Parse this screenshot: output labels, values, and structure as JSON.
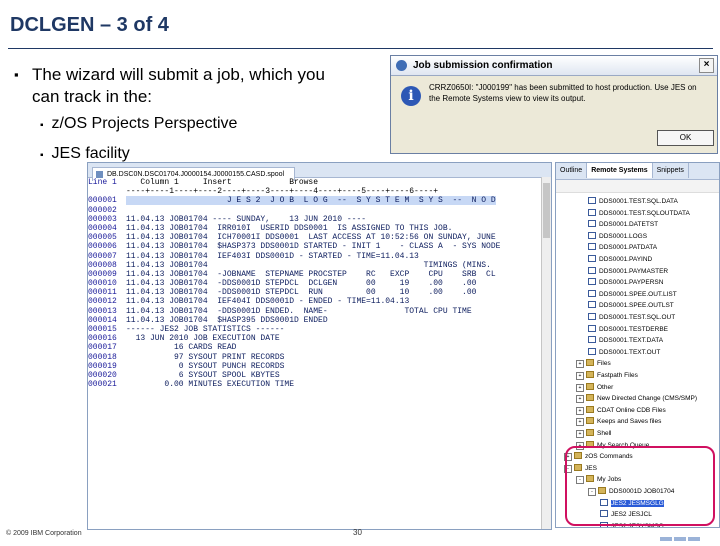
{
  "slide": {
    "title": "DCLGEN – 3 of 4",
    "bullet_main_line1": "The wizard will submit a job, which you",
    "bullet_main_line2": "can track in the:",
    "bullet_sub1": "z/OS Projects Perspective",
    "bullet_sub2": "JES facility",
    "footer_copyright": "© 2009 IBM Corporation",
    "page_number": "30"
  },
  "dialog": {
    "title": "Job submission confirmation",
    "message": "CRRZ0650I: \"J000199\" has been submitted to host production. Use JES on the Remote Systems view to view its output.",
    "ok_label": "OK",
    "close_glyph": "×",
    "info_glyph": "i"
  },
  "editor": {
    "tab_label": "DB.DSC0N.DSC01704.J0000154.J0000155.CASD.spool",
    "rows": [
      {
        "ln": "Line 1",
        "txt": "   Column 1     Insert            Browse",
        "hdr": true
      },
      {
        "ln": "",
        "txt": "----+----1----+----2----+----3----+----4----+----5----+----6----+",
        "hdr": true
      },
      {
        "ln": "000001",
        "txt": "                     J E S 2  J O B  L O G  --  S Y S T E M  S Y S  --  N O D",
        "hl": true
      },
      {
        "ln": "000002",
        "txt": ""
      },
      {
        "ln": "000003",
        "txt": "11.04.13 JOB01704 ---- SUNDAY,    13 JUN 2010 ----"
      },
      {
        "ln": "000004",
        "txt": "11.04.13 JOB01704  IRR010I  USERID DDS0001  IS ASSIGNED TO THIS JOB."
      },
      {
        "ln": "000005",
        "txt": "11.04.13 JOB01704  ICH70001I DDS0001  LAST ACCESS AT 10:52:56 ON SUNDAY, JUNE"
      },
      {
        "ln": "000006",
        "txt": "11.04.13 JOB01704  $HASP373 DDS0001D STARTED - INIT 1    - CLASS A  - SYS NODE"
      },
      {
        "ln": "000007",
        "txt": "11.04.13 JOB01704  IEF403I DDS0001D - STARTED - TIME=11.04.13"
      },
      {
        "ln": "000008",
        "txt": "11.04.13 JOB01704                                             TIMINGS (MINS."
      },
      {
        "ln": "000009",
        "txt": "11.04.13 JOB01704  -JOBNAME  STEPNAME PROCSTEP    RC   EXCP    CPU    SRB  CL"
      },
      {
        "ln": "000010",
        "txt": "11.04.13 JOB01704  -DDS0001D STEPDCL  DCLGEN      00     19    .00    .00"
      },
      {
        "ln": "000011",
        "txt": "11.04.13 JOB01704  -DDS0001D STEPDCL  RUN         00     10    .00    .00"
      },
      {
        "ln": "000012",
        "txt": "11.04.13 JOB01704  IEF404I DDS0001D - ENDED - TIME=11.04.13"
      },
      {
        "ln": "000013",
        "txt": "11.04.13 JOB01704  -DDS0001D ENDED.  NAME-                TOTAL CPU TIME"
      },
      {
        "ln": "000014",
        "txt": "11.04.13 JOB01704  $HASP395 DDS0001D ENDED"
      },
      {
        "ln": "000015",
        "txt": "------ JES2 JOB STATISTICS ------"
      },
      {
        "ln": "000016",
        "txt": "  13 JUN 2010 JOB EXECUTION DATE"
      },
      {
        "ln": "000017",
        "txt": "          16 CARDS READ"
      },
      {
        "ln": "000018",
        "txt": "          97 SYSOUT PRINT RECORDS"
      },
      {
        "ln": "000019",
        "txt": "           0 SYSOUT PUNCH RECORDS"
      },
      {
        "ln": "000020",
        "txt": "           6 SYSOUT SPOOL KBYTES"
      },
      {
        "ln": "000021",
        "txt": "        0.00 MINUTES EXECUTION TIME"
      }
    ]
  },
  "remote_panel": {
    "tabs": [
      "Outline",
      "Remote Systems",
      "Snippets"
    ],
    "active_tab": "Remote Systems",
    "tree": [
      {
        "label": "DDS0001.TEST.SQL.DATA",
        "depth": 3,
        "kind": "ds"
      },
      {
        "label": "DDS0001.TEST.SQLOUTDATA",
        "depth": 3,
        "kind": "ds"
      },
      {
        "label": "DDS0001.DATETST",
        "depth": 3,
        "kind": "ds"
      },
      {
        "label": "DDS0001.LOGS",
        "depth": 3,
        "kind": "ds"
      },
      {
        "label": "DDS0001.PATDATA",
        "depth": 3,
        "kind": "ds"
      },
      {
        "label": "DDS0001.PAYIND",
        "depth": 3,
        "kind": "ds"
      },
      {
        "label": "DDS0001.PAYMASTER",
        "depth": 3,
        "kind": "ds"
      },
      {
        "label": "DDS0001.PAYPERSN",
        "depth": 3,
        "kind": "ds"
      },
      {
        "label": "DDS0001.SPEE.OUT.LIST",
        "depth": 3,
        "kind": "ds"
      },
      {
        "label": "DDS0001.SPEE.OUTLST",
        "depth": 3,
        "kind": "ds"
      },
      {
        "label": "DDS0001.TEST.SQL.OUT",
        "depth": 3,
        "kind": "ds"
      },
      {
        "label": "DDS0001.TESTDERBE",
        "depth": 3,
        "kind": "ds"
      },
      {
        "label": "DDS0001.TEXT.DATA",
        "depth": 3,
        "kind": "ds"
      },
      {
        "label": "DDS0001.TEXT.OUT",
        "depth": 3,
        "kind": "ds"
      },
      {
        "label": "Files",
        "depth": 2,
        "kind": "folder",
        "exp": "+"
      },
      {
        "label": "Fastpath Files",
        "depth": 2,
        "kind": "folder",
        "exp": "+"
      },
      {
        "label": "Other",
        "depth": 2,
        "kind": "folder",
        "exp": "+"
      },
      {
        "label": "New Directed Change (CMS/SMP)",
        "depth": 2,
        "kind": "folder",
        "exp": "+"
      },
      {
        "label": "CDAT Online CDB Files",
        "depth": 2,
        "kind": "folder",
        "exp": "+"
      },
      {
        "label": "Keeps and Saves files",
        "depth": 2,
        "kind": "folder",
        "exp": "+"
      },
      {
        "label": "Shell",
        "depth": 2,
        "kind": "folder",
        "exp": "+"
      },
      {
        "label": "My Search Queue",
        "depth": 2,
        "kind": "folder",
        "exp": "+"
      },
      {
        "label": "zOS Commands",
        "depth": 1,
        "kind": "folder",
        "exp": "+"
      },
      {
        "label": "JES",
        "depth": 1,
        "kind": "folder",
        "exp": "-"
      },
      {
        "label": "My Jobs",
        "depth": 2,
        "kind": "folder",
        "exp": "-"
      },
      {
        "label": "DDS0001D JOB01704",
        "depth": 3,
        "kind": "folder",
        "exp": "-"
      },
      {
        "label": "JES2 JESMSGLG",
        "depth": 4,
        "kind": "ds",
        "selected": true
      },
      {
        "label": "JES2 JESJCL",
        "depth": 4,
        "kind": "ds"
      },
      {
        "label": "JES2 JESYSMSG",
        "depth": 4,
        "kind": "ds"
      }
    ]
  }
}
